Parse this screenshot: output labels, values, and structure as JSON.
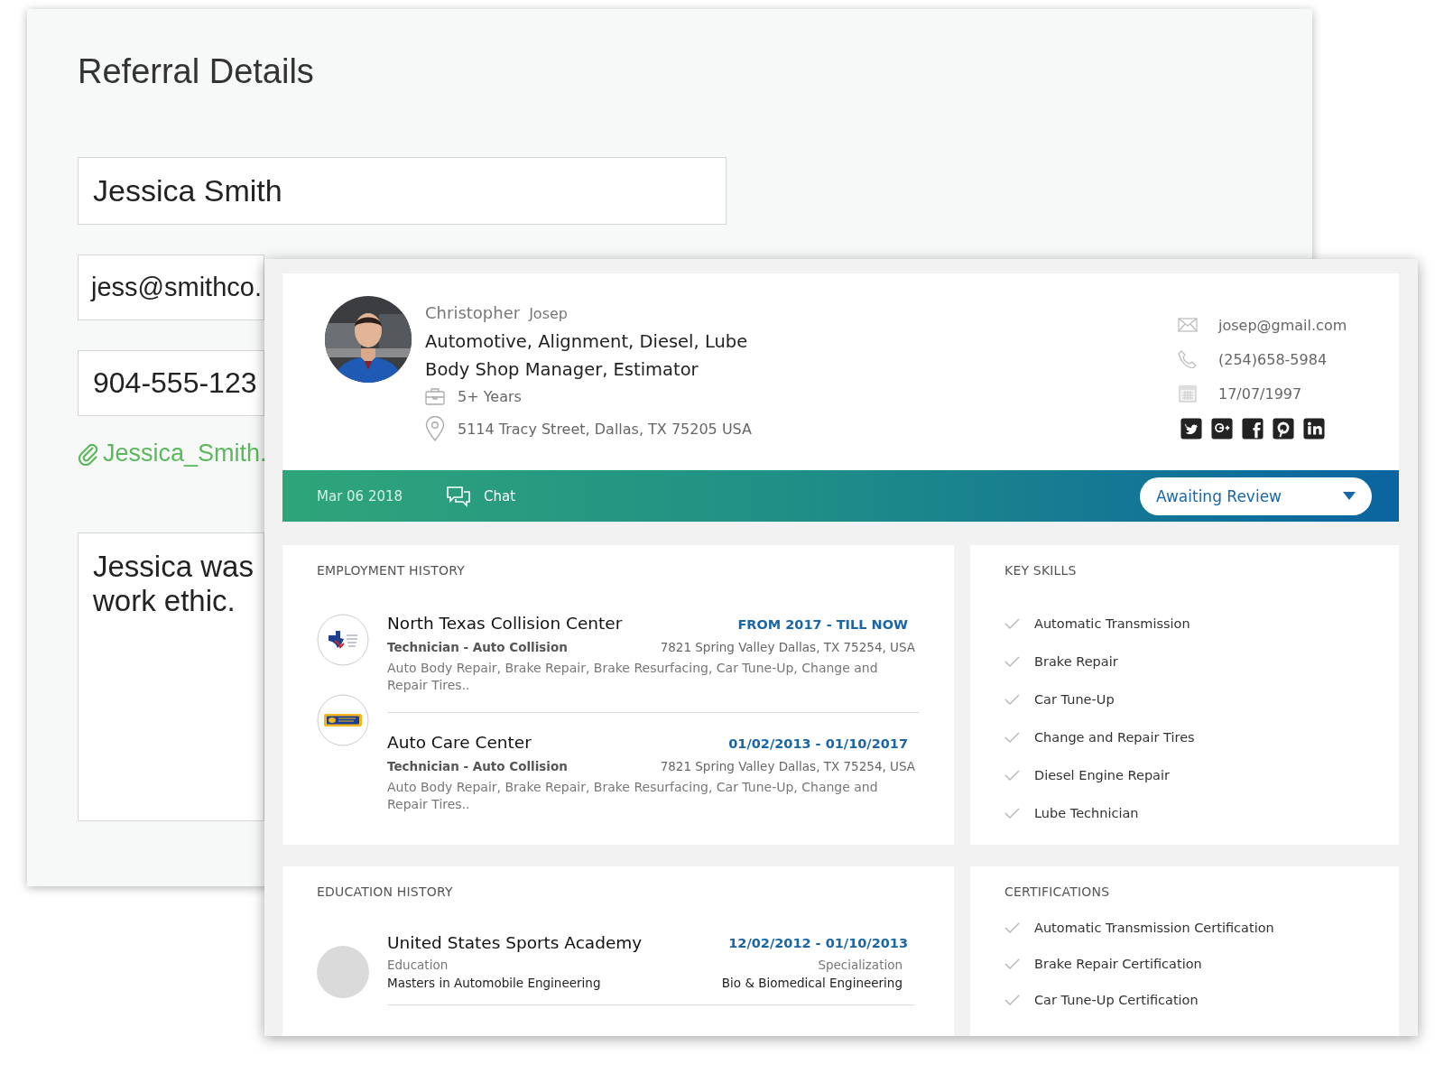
{
  "referral_window": {
    "title": "Referral Details",
    "name_field": {
      "value": "Jessica Smith"
    },
    "email_field": {
      "value": "jess@smithco."
    },
    "phone_field": {
      "value": "904-555-123"
    },
    "attachment": {
      "label": "Jessica_Smith."
    },
    "note_field": {
      "lines": [
        "Jessica was",
        "work ethic."
      ]
    }
  },
  "profile_window": {
    "header": {
      "first_name": "Christopher",
      "last_name": "Josep",
      "headline_lines": [
        "Automotive, Alignment, Diesel, Lube",
        "Body Shop Manager, Estimator"
      ],
      "experience": "5+ Years",
      "address": "5114 Tracy Street, Dallas, TX 75205 USA",
      "email": "josep@gmail.com",
      "phone": "(254)658-5984",
      "birth_date": "17/07/1997",
      "social": [
        {
          "kind": "twitter"
        },
        {
          "kind": "google_plus"
        },
        {
          "kind": "facebook"
        },
        {
          "kind": "pinterest"
        },
        {
          "kind": "linkedin"
        }
      ]
    },
    "banner": {
      "date": "Mar 06 2018",
      "chat": "Chat",
      "status_dropdown": {
        "value": "Awaiting Review"
      }
    },
    "employment_history": {
      "title": "EMPLOYMENT HISTORY",
      "entries": [
        {
          "kind": "flag",
          "company": "North Texas Collision Center",
          "period": "FROM 2017 - TILL NOW",
          "role": "Technician - Auto Collision",
          "address": "7821 Spring Valley Dallas, TX 75254, USA",
          "description": "Auto Body Repair, Brake Repair, Brake Resurfacing, Car Tune-Up, Change and Repair Tires.."
        },
        {
          "kind": "badge",
          "company": "Auto Care Center",
          "period": "01/02/2013 - 01/10/2017",
          "role": "Technician - Auto Collision",
          "address": "7821 Spring Valley Dallas, TX 75254, USA",
          "description": "Auto Body Repair, Brake Repair, Brake Resurfacing, Car Tune-Up, Change and Repair Tires.."
        }
      ]
    },
    "key_skills": {
      "title": "KEY SKILLS",
      "items": [
        "Automatic Transmission",
        "Brake Repair",
        "Car Tune-Up",
        "Change and Repair Tires",
        "Diesel Engine Repair",
        "Lube Technician"
      ]
    },
    "education_history": {
      "title": "EDUCATION HISTORY",
      "entries": [
        {
          "kind": "blank",
          "school": "United States Sports Academy",
          "period": "12/02/2012 - 01/10/2013",
          "field_label": "Education",
          "field_value": "Masters in Automobile Engineering",
          "specialization_label": "Specialization",
          "specialization_value": "Bio & Biomedical Engineering"
        }
      ]
    },
    "certifications": {
      "title": "CERTIFICATIONS",
      "items": [
        "Automatic Transmission Certification",
        "Brake Repair Certification",
        "Car Tune-Up Certification"
      ]
    }
  }
}
